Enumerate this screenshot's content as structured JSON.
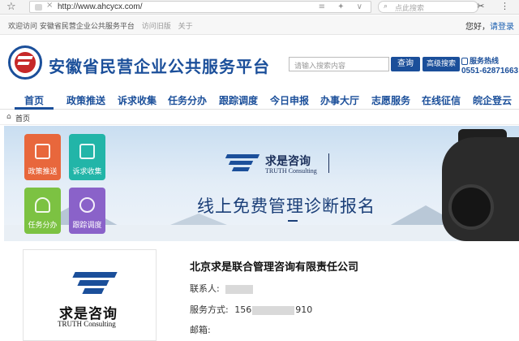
{
  "browser": {
    "url": "http://www.ahcycx.com/",
    "url_right_icons": "≡ ✦ ∨",
    "search_placeholder": "点此搜索",
    "right_icons": "✂ ⋮"
  },
  "util": {
    "welcome": "欢迎访问 安徽省民营企业公共服务平台",
    "old_version": "访问旧版",
    "about": "关于",
    "greeting": "您好，",
    "login": "请登录"
  },
  "header": {
    "title": "安徽省民营企业公共服务平台",
    "search_placeholder": "请输入搜索内容",
    "search_button": "查询",
    "advanced_button": "高级搜索",
    "hotline_label": "服务热线",
    "hotline_number": "0551-62871663"
  },
  "nav": {
    "items": [
      "首页",
      "政策推送",
      "诉求收集",
      "任务分办",
      "跟踪调度",
      "今日申报",
      "办事大厅",
      "志愿服务",
      "在线征信",
      "皖企登云"
    ]
  },
  "breadcrumb": {
    "home": "首页"
  },
  "banner": {
    "tiles": [
      "政策推送",
      "诉求收集",
      "任务分办",
      "跟踪调度"
    ],
    "brand_cn": "求是咨询",
    "brand_en": "TRUTH Consulting",
    "title": "线上免费管理诊断报名"
  },
  "company": {
    "logo_cn": "求是咨询",
    "logo_en": "TRUTH Consulting",
    "name": "北京求是联合管理咨询有限责任公司",
    "contact_label": "联系人:",
    "service_label": "服务方式:",
    "phone_prefix": "156",
    "phone_suffix": "910",
    "email_label": "邮箱:"
  },
  "colors": {
    "brand_blue": "#1b4f9a",
    "tile_orange": "#e8673c",
    "tile_teal": "#22b5a8",
    "tile_green": "#7cc242",
    "tile_purple": "#8a62c9"
  }
}
